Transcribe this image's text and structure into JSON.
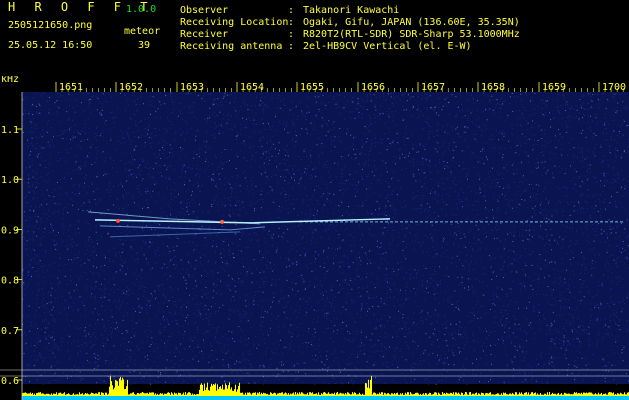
{
  "header": {
    "app_name": "H R O F F T",
    "version": "1.0.0",
    "filename": "2505121650.png",
    "meteor_label": "meteor",
    "timestamp": "25.05.12 16:50",
    "meteor_count": "39",
    "info": [
      {
        "key": "Observer",
        "value": "Takanori Kawachi"
      },
      {
        "key": "Receiving Location",
        "value": "Ogaki, Gifu, JAPAN (136.60E, 35.35N)"
      },
      {
        "key": "Receiver",
        "value": "R820T2(RTL-SDR) SDR-Sharp 53.1000MHz"
      },
      {
        "key": "Receiving antenna",
        "value": "2el-HB9CV Vertical (el. E-W)"
      }
    ],
    "separator": ":"
  },
  "chart_data": {
    "type": "heatmap",
    "y_unit": "kHz",
    "x_ticks": [
      "1651",
      "1652",
      "1653",
      "1654",
      "1655",
      "1656",
      "1657",
      "1658",
      "1659",
      "1700"
    ],
    "y_ticks": [
      1.1,
      1.0,
      0.9,
      0.8,
      0.7,
      0.6
    ],
    "ylim": [
      0.59,
      1.2
    ],
    "carrier_khz": 0.915,
    "colors": {
      "background": "#000000",
      "noise": "#1b2a8f",
      "axis_text": "#ffff3a",
      "carrier": "#8fd8ff",
      "histogram": "#ffff00",
      "baseline": "#00c8ff"
    }
  }
}
